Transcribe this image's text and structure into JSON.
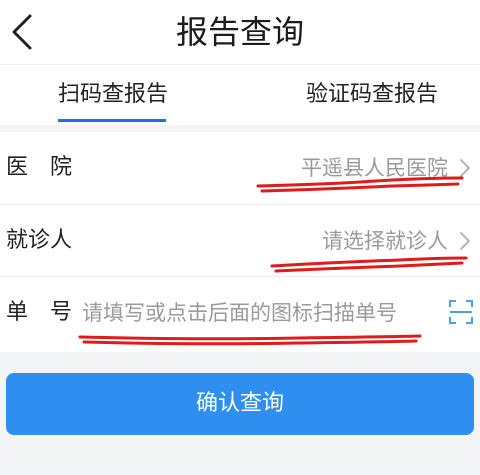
{
  "header": {
    "title": "报告查询",
    "back_icon": "chevron-left-icon"
  },
  "tabs": [
    {
      "label": "扫码查报告",
      "active": true
    },
    {
      "label": "验证码查报告",
      "active": false
    }
  ],
  "form": {
    "hospital": {
      "label": "医　院",
      "value": "平遥县人民医院"
    },
    "patient": {
      "label": "就诊人",
      "placeholder": "请选择就诊人"
    },
    "number": {
      "label": "单　号",
      "placeholder": "请填写或点击后面的图标扫描单号",
      "icon": "scan-icon"
    }
  },
  "confirm_button": {
    "label": "确认查询"
  },
  "colors": {
    "accent": "#1a73e8",
    "button": "#2f8ff0",
    "annotation": "#e01b1b"
  }
}
